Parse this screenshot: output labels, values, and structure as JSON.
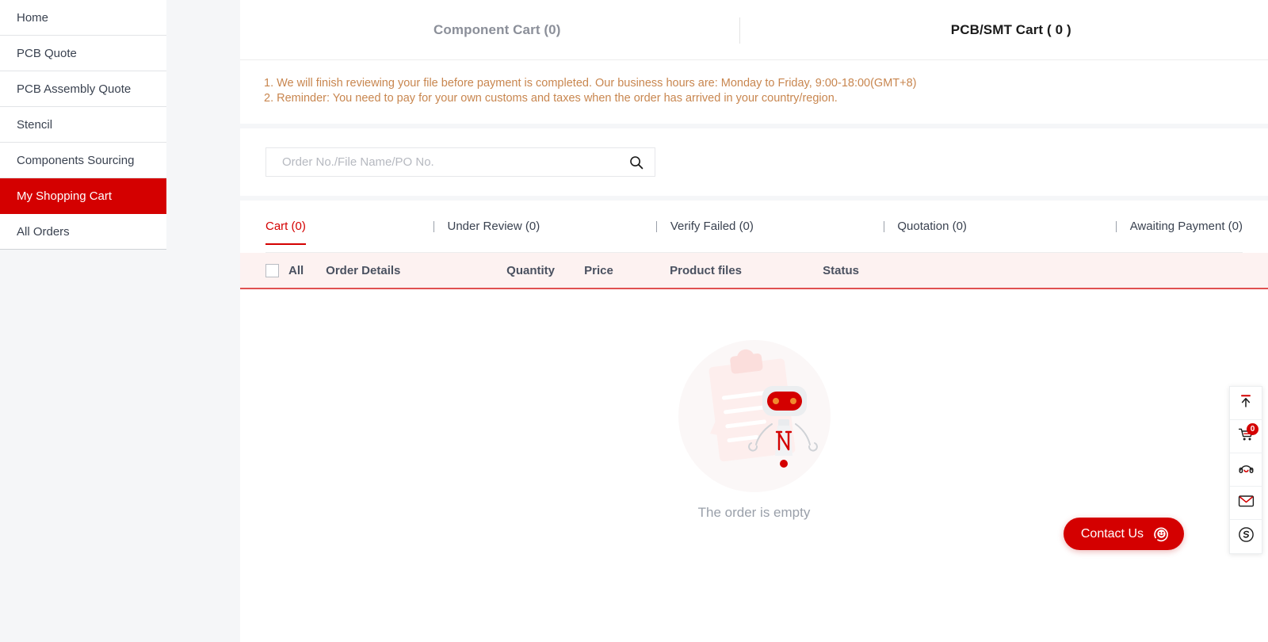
{
  "sidebar": {
    "items": [
      {
        "label": "Home",
        "active": false
      },
      {
        "label": "PCB Quote",
        "active": false
      },
      {
        "label": "PCB Assembly Quote",
        "active": false
      },
      {
        "label": "Stencil",
        "active": false
      },
      {
        "label": "Components Sourcing",
        "active": false
      },
      {
        "label": "My Shopping Cart",
        "active": true
      },
      {
        "label": "All Orders",
        "active": false
      }
    ]
  },
  "cart_tabs": {
    "component": "Component Cart (0)",
    "pcb_smt": "PCB/SMT Cart ( 0 )"
  },
  "notice": {
    "line1": "1. We will finish reviewing your file before payment is completed. Our business hours are: Monday to Friday, 9:00-18:00(GMT+8)",
    "line2": "2. Reminder: You need to pay for your own customs and taxes when the order has arrived in your country/region."
  },
  "search": {
    "placeholder": "Order No./File Name/PO No.",
    "value": "",
    "icon": "search-icon"
  },
  "status_tabs": [
    {
      "label": "Cart (0)",
      "active": true
    },
    {
      "label": "Under Review (0)",
      "active": false
    },
    {
      "label": "Verify Failed (0)",
      "active": false
    },
    {
      "label": "Quotation (0)",
      "active": false
    },
    {
      "label": "Awaiting Payment (0)",
      "active": false
    }
  ],
  "table": {
    "select_all_label": "All",
    "columns": [
      "Order Details",
      "Quantity",
      "Price",
      "Product files",
      "Status"
    ],
    "rows": []
  },
  "empty_state": {
    "text": "The order is empty",
    "illustration": "empty-robot-clipboard-illustration"
  },
  "dock": [
    {
      "name": "back-to-top-icon",
      "badge": null
    },
    {
      "name": "shopping-cart-icon",
      "badge": "0"
    },
    {
      "name": "headset-support-icon",
      "badge": null
    },
    {
      "name": "mail-envelope-icon",
      "badge": null
    },
    {
      "name": "skype-icon",
      "badge": null
    }
  ],
  "contact": {
    "label": "Contact Us",
    "icon": "chat-support-icon"
  },
  "colors": {
    "brand_red": "#d40000",
    "notice_orange": "#c8864f",
    "table_head_bg": "#fdf2f1",
    "page_bg": "#f5f6f8",
    "text_dark": "#3a4250",
    "text_muted": "#9aa0aa"
  }
}
